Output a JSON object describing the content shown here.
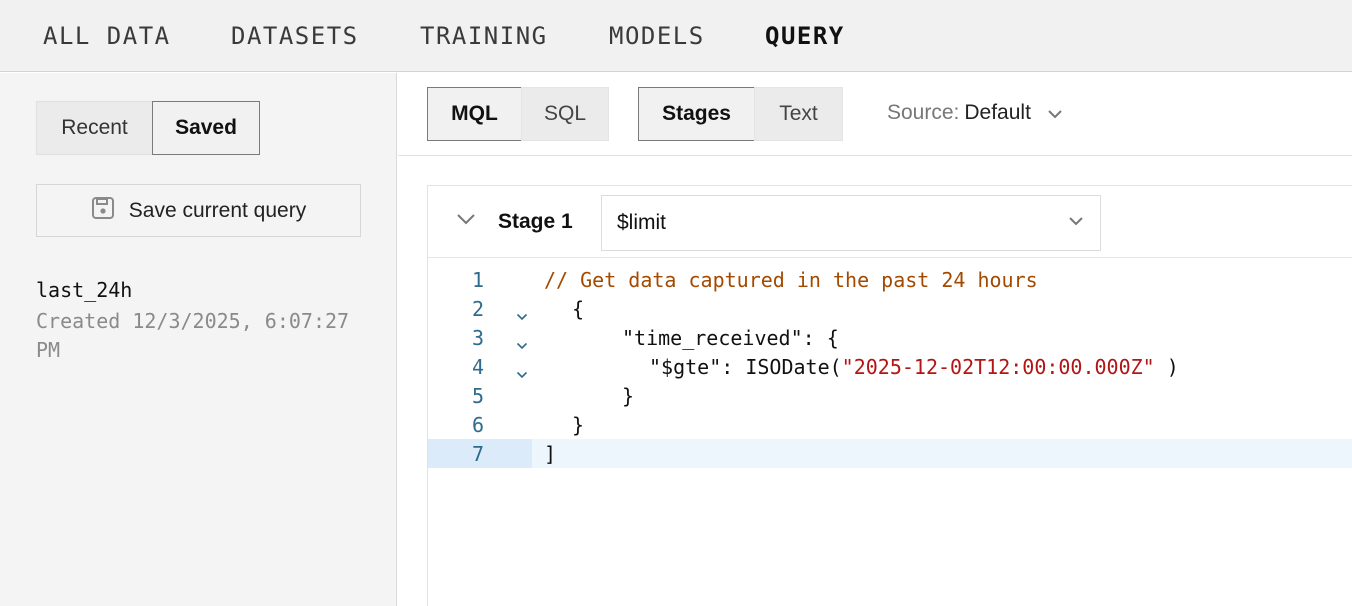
{
  "nav": {
    "tabs": [
      {
        "label": "ALL DATA"
      },
      {
        "label": "DATASETS"
      },
      {
        "label": "TRAINING"
      },
      {
        "label": "MODELS"
      },
      {
        "label": "QUERY",
        "active": true
      }
    ]
  },
  "sidebar": {
    "segments": {
      "recent": "Recent",
      "saved": "Saved",
      "selected": "Saved"
    },
    "save_button_label": "Save current query",
    "saved_queries": [
      {
        "name": "last_24h",
        "created": "Created 12/3/2025, 6:07:27 PM"
      }
    ]
  },
  "toolbar": {
    "language": {
      "mql": "MQL",
      "sql": "SQL",
      "selected": "MQL"
    },
    "mode": {
      "stages": "Stages",
      "text": "Text",
      "selected": "Stages"
    },
    "source_label": "Source:",
    "source_value": "Default"
  },
  "stage": {
    "label": "Stage 1",
    "operator": "$limit"
  },
  "editor": {
    "active_line": 7,
    "lines": [
      {
        "num": "1",
        "tokens": [
          {
            "text": "// Get data captured in the past 24 hours",
            "type": "comment"
          }
        ]
      },
      {
        "num": "2",
        "fold": true,
        "tokens": [
          {
            "text": "{",
            "type": "text"
          }
        ]
      },
      {
        "num": "3",
        "fold": true,
        "tokens": [
          {
            "text": "\"time_received\": {",
            "type": "text"
          }
        ]
      },
      {
        "num": "4",
        "fold": true,
        "tokens": [
          {
            "text": "\"$gte\": ISODate(",
            "type": "text"
          },
          {
            "text": "\"2025-12-02T12:00:00.000Z\"",
            "type": "string"
          },
          {
            "text": " )",
            "type": "text"
          }
        ]
      },
      {
        "num": "5",
        "tokens": [
          {
            "text": "}",
            "type": "text"
          }
        ]
      },
      {
        "num": "6",
        "tokens": [
          {
            "text": "}",
            "type": "text"
          }
        ]
      },
      {
        "num": "7",
        "tokens": [
          {
            "text": "]",
            "type": "text"
          }
        ]
      }
    ]
  },
  "colors": {
    "comment": "#a34a00",
    "string": "#b31414",
    "line_number": "#2e6b8c",
    "active_line_bg": "#eef6fd"
  },
  "icons": {
    "save": "floppy-disk-icon",
    "dropdown": "chevron-down-icon",
    "collapse": "chevron-down-icon",
    "fold": "fold-chevron-icon"
  }
}
